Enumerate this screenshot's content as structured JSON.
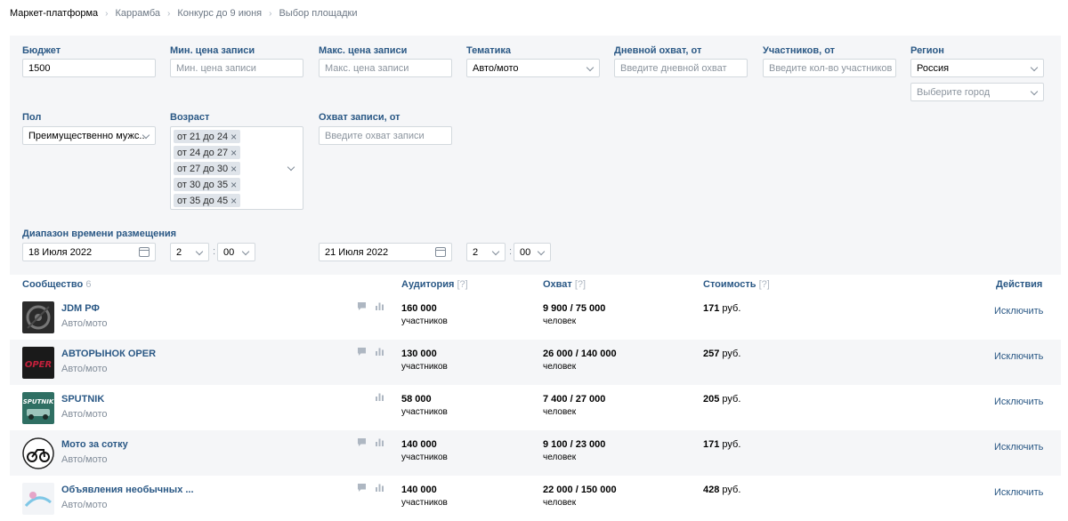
{
  "breadcrumb": [
    "Маркет-платформа",
    "Каррамба",
    "Конкурс до 9 июня",
    "Выбор площадки"
  ],
  "filters": {
    "budget": {
      "label": "Бюджет",
      "value": "1500"
    },
    "min_price": {
      "label": "Мин. цена записи",
      "placeholder": "Мин. цена записи"
    },
    "max_price": {
      "label": "Макс. цена записи",
      "placeholder": "Макс. цена записи"
    },
    "topic": {
      "label": "Тематика",
      "value": "Авто/мото"
    },
    "daily_reach": {
      "label": "Дневной охват, от",
      "placeholder": "Введите дневной охват"
    },
    "members": {
      "label": "Участников, от",
      "placeholder": "Введите кол-во участников"
    },
    "region": {
      "label": "Регион",
      "value": "Россия",
      "city_placeholder": "Выберите город"
    },
    "gender": {
      "label": "Пол",
      "value": "Преимущественно мужс..."
    },
    "age": {
      "label": "Возраст",
      "tags": [
        "от 21 до 24",
        "от 24 до 27",
        "от 27 до 30",
        "от 30 до 35",
        "от 35 до 45"
      ]
    },
    "post_reach": {
      "label": "Охват записи, от",
      "placeholder": "Введите охват записи"
    },
    "time_range": {
      "label": "Диапазон времени размещения",
      "from_date": "18 Июля 2022",
      "from_hour": "2",
      "from_min": "00",
      "to_date": "21 Июля 2022",
      "to_hour": "2",
      "to_min": "00",
      "separator": ":"
    }
  },
  "table": {
    "headers": {
      "community": "Сообщество",
      "community_count": "6",
      "audience": "Аудитория",
      "reach": "Охват",
      "cost": "Стоимость",
      "help": "[?]",
      "actions": "Действия"
    },
    "rows": [
      {
        "name": "JDM РФ",
        "category": "Авто/мото",
        "audience": "160 000",
        "audience_unit": "участников",
        "reach": "9 900 / 75 000",
        "reach_unit": "человек",
        "cost": "171",
        "cost_unit": "руб.",
        "action": "Исключить",
        "icons": [
          "comment-icon",
          "stats-icon"
        ]
      },
      {
        "name": "АВТОРЫНОК OPER",
        "category": "Авто/мото",
        "audience": "130 000",
        "audience_unit": "участников",
        "reach": "26 000 / 140 000",
        "reach_unit": "человек",
        "cost": "257",
        "cost_unit": "руб.",
        "action": "Исключить",
        "icons": [
          "comment-icon",
          "stats-icon"
        ]
      },
      {
        "name": "SPUTNIK",
        "category": "Авто/мото",
        "audience": "58 000",
        "audience_unit": "участников",
        "reach": "7 400 / 27 000",
        "reach_unit": "человек",
        "cost": "205",
        "cost_unit": "руб.",
        "action": "Исключить",
        "icons": [
          "stats-icon"
        ]
      },
      {
        "name": "Мото за сотку",
        "category": "Авто/мото",
        "audience": "140 000",
        "audience_unit": "участников",
        "reach": "9 100 / 23 000",
        "reach_unit": "человек",
        "cost": "171",
        "cost_unit": "руб.",
        "action": "Исключить",
        "icons": [
          "comment-icon",
          "stats-icon"
        ]
      },
      {
        "name": "Объявления необычных ...",
        "category": "Авто/мото",
        "audience": "140 000",
        "audience_unit": "участников",
        "reach": "22 000 / 150 000",
        "reach_unit": "человек",
        "cost": "428",
        "cost_unit": "руб.",
        "action": "Исключить",
        "icons": [
          "comment-icon",
          "stats-icon"
        ]
      }
    ],
    "avatars": [
      {
        "text": "",
        "colors": [
          "#2b2b2b",
          "#777777"
        ]
      },
      {
        "text": "OPER",
        "colors": [
          "#1a1a1a",
          "#c2203b"
        ]
      },
      {
        "text": "SPUTNIK",
        "colors": [
          "#2f6f63",
          "#ffffff"
        ]
      },
      {
        "text": "",
        "colors": [
          "#ffffff",
          "#111111"
        ]
      },
      {
        "text": "",
        "colors": [
          "#f2f4f7",
          "#7fc7e6"
        ]
      }
    ]
  },
  "colors": {
    "link": "#2a5885",
    "panel": "#f5f6f8",
    "muted": "#818c99",
    "border": "#d3d9de"
  }
}
